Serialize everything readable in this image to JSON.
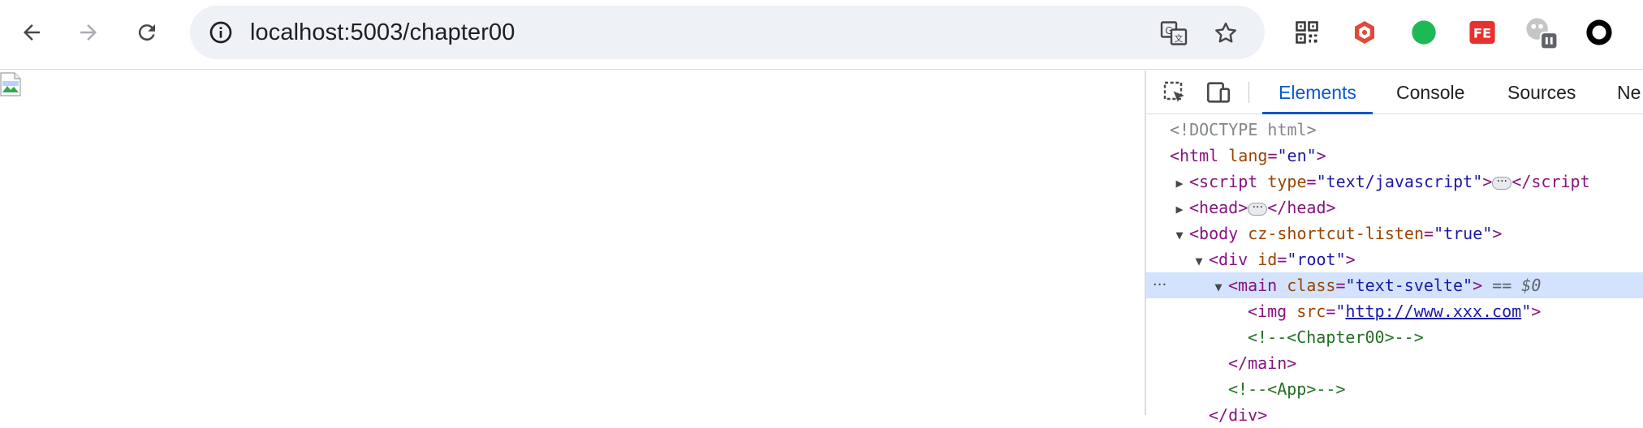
{
  "browser": {
    "url": "localhost:5003/chapter00",
    "colors": {
      "accent": "#0b57d0",
      "omnibox_bg": "#eef1f6",
      "selection_bg": "#d3e3fd"
    },
    "nav_icons": [
      "back-arrow-icon",
      "forward-arrow-icon",
      "reload-icon"
    ],
    "omnibox_icons": [
      "site-info-icon",
      "translate-icon",
      "bookmark-star-icon"
    ],
    "extension_icons": [
      "qr-code-icon",
      "red-hexagon-extension-icon",
      "green-circle-extension-icon",
      "fe-extension-icon",
      "gray-extension-paused-icon",
      "profile-avatar-icon"
    ],
    "extension_labels": {
      "fe": "FE"
    }
  },
  "page": {
    "content_icon": "broken-image-icon"
  },
  "devtools": {
    "tool_icons": [
      "inspect-element-icon",
      "device-toolbar-icon"
    ],
    "tabs": [
      "Elements",
      "Console",
      "Sources",
      "Ne"
    ],
    "active_tab": "Elements",
    "dom": {
      "doctype": "<!DOCTYPE html>",
      "html_open": "<html",
      "html_attr": "lang",
      "html_val": "\"en\"",
      "close_gt": ">",
      "eq": "=",
      "script_open": "<script",
      "script_attr": "type",
      "script_val": "\"text/javascript\"",
      "script_close": "</script",
      "head_open": "<head>",
      "head_close": "</head>",
      "body_open": "<body",
      "body_attr": "cz-shortcut-listen",
      "body_val": "\"true\"",
      "div_open": "<div",
      "div_attr": "id",
      "div_val": "\"root\"",
      "main_open": "<main",
      "main_attr": "class",
      "main_val": "\"text-svelte\"",
      "selected_ref": "== $0",
      "img_open": "<img",
      "img_attr": "src",
      "img_quote": "\"",
      "img_url": "http://www.xxx.com",
      "comment_chapter": "<!--<Chapter00>-->",
      "main_close": "</main>",
      "comment_app": "<!--<App>-->",
      "div_close": "</div>",
      "row_menu": "···",
      "ellipsis": "···"
    }
  }
}
